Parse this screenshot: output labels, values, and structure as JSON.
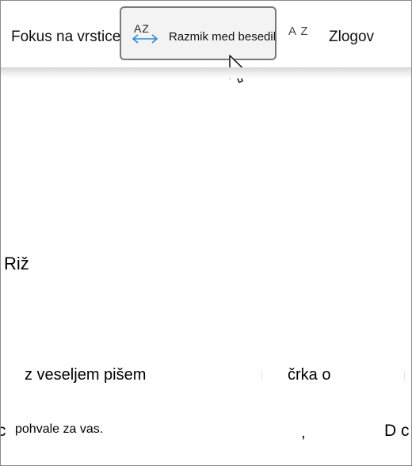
{
  "toolbar": {
    "line_focus_label": "Fokus na vrstice",
    "spacing_tooltip_icon_text": "AZ",
    "spacing_tooltip_label": "Razmik med besedilom",
    "spacing_background_icon_text": "A Z",
    "syllables_label": "Zlogov"
  },
  "document": {
    "fragments": [
      "Riž",
      "z veseljem pišem",
      "črka o",
      "c",
      "pohvale za vas.",
      ",",
      "D c"
    ]
  },
  "colors": {
    "icon_arrow": "#2b88d8",
    "tooltip_background": "#f3f3f3",
    "tooltip_border": "#7a7a7a"
  }
}
